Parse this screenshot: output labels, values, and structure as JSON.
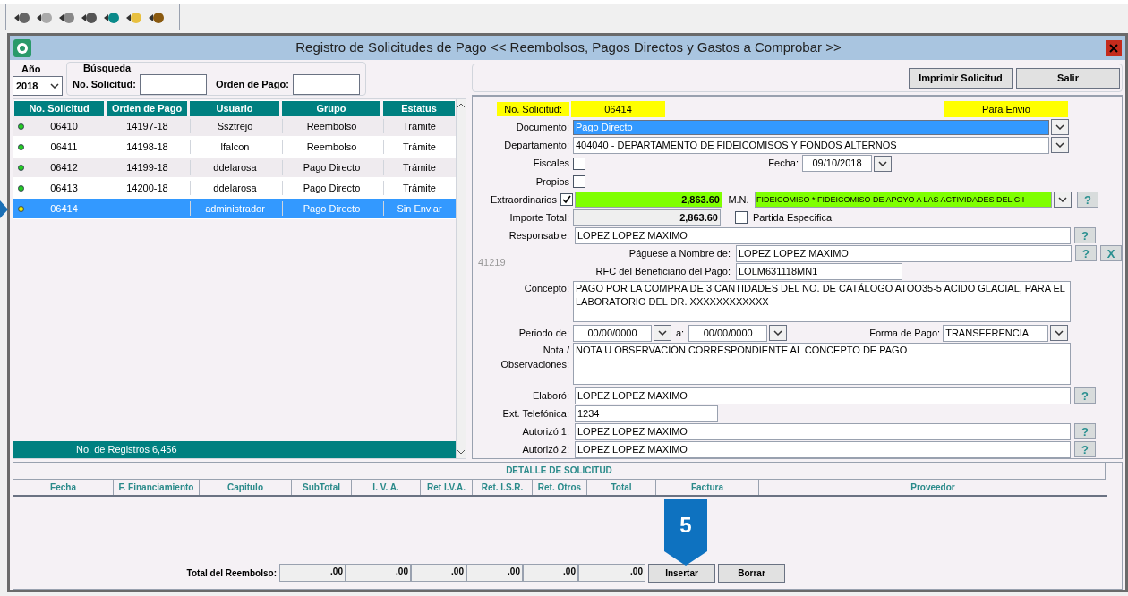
{
  "window": {
    "title": "Registro de Solicitudes de Pago << Reembolsos, Pagos Directos y Gastos a Comprobar >>"
  },
  "year": {
    "label": "Año",
    "value": "2018"
  },
  "search": {
    "label": "Búsqueda",
    "fields": [
      {
        "label": "No. Solicitud:"
      },
      {
        "label": "Orden de Pago:"
      }
    ]
  },
  "buttons": [
    "Imprimir Solicitud",
    "Salir"
  ],
  "table": {
    "columns": [
      "No. Solicitud",
      "Orden de Pago",
      "Usuario",
      "Grupo",
      "Estatus"
    ],
    "rows": [
      {
        "cells": [
          "06410",
          "14197-18",
          "Ssztrejo",
          "Reembolso",
          "Trámite"
        ],
        "color": "#22cc22",
        "selected": false
      },
      {
        "cells": [
          "06411",
          "14198-18",
          "lfalcon",
          "Reembolso",
          "Trámite"
        ],
        "color": "#22cc22",
        "selected": false
      },
      {
        "cells": [
          "06412",
          "14199-18",
          "ddelarosa",
          "Pago Directo",
          "Trámite"
        ],
        "color": "#22cc22",
        "selected": false
      },
      {
        "cells": [
          "06413",
          "14200-18",
          "ddelarosa",
          "Pago Directo",
          "Trámite"
        ],
        "color": "#22cc22",
        "selected": false
      },
      {
        "cells": [
          "06414",
          "",
          "administrador",
          "Pago Directo",
          "Sin Enviar"
        ],
        "color": "#eeee00",
        "selected": true
      }
    ],
    "footer": "No. de Registros 6,456"
  },
  "form": {
    "solicitud": {
      "label": "No. Solicitud:",
      "value": "06414",
      "status": "Para Envio"
    },
    "documento": {
      "label": "Documento:",
      "value": "Pago Directo"
    },
    "departamento": {
      "label": "Departamento:",
      "value": "404040 - DEPARTAMENTO DE FIDEICOMISOS Y FONDOS ALTERNOS"
    },
    "fiscales": {
      "label": "Fiscales",
      "checked": false
    },
    "fecha": {
      "label": "Fecha:",
      "value": "09/10/2018"
    },
    "propios": {
      "label": "Propios",
      "checked": false
    },
    "extraordinarios": {
      "label": "Extraordinarios",
      "checked": true,
      "amount": "2,863.60",
      "currency": "M.N.",
      "fund": "FIDEICOMISO * FIDEICOMISO DE APOYO A LAS ACTIVIDADES DEL CII"
    },
    "importe": {
      "label": "Importe Total:",
      "value": "2,863.60"
    },
    "partida": {
      "label": "Partida Especifica",
      "checked": false
    },
    "responsable": {
      "label": "Responsable:",
      "value": "LOPEZ LOPEZ MAXIMO"
    },
    "side_number": "41219",
    "paguese": {
      "label": "Páguese a Nombre de:",
      "value": "LOPEZ LOPEZ MAXIMO"
    },
    "rfc": {
      "label": "RFC del Beneficiario del Pago:",
      "value": "LOLM631118MN1"
    },
    "concepto": {
      "label": "Concepto:",
      "value": "PAGO POR LA COMPRA DE 3 CANTIDADES DEL NO. DE CATÁLOGO ATOO35-5 ACIDO GLACIAL, PARA EL LABORATORIO DEL DR. XXXXXXXXXXXX"
    },
    "periodo": {
      "label": "Periodo de:",
      "from": "00/00/0000",
      "to_label": "a:",
      "to": "00/00/0000"
    },
    "forma": {
      "label": "Forma de Pago:",
      "value": "TRANSFERENCIA"
    },
    "nota": {
      "label": "Nota / Observaciones:",
      "value": "NOTA U OBSERVACIÓN CORRESPONDIENTE AL CONCEPTO DE PAGO"
    },
    "elaboro": {
      "label": "Elaboró:",
      "value": "LOPEZ LOPEZ MAXIMO"
    },
    "ext": {
      "label": "Ext. Telefónica:",
      "value": "1234"
    },
    "autorizo1": {
      "label": "Autorizó 1:",
      "value": "LOPEZ LOPEZ MAXIMO"
    },
    "autorizo2": {
      "label": "Autorizó 2:",
      "value": "LOPEZ LOPEZ MAXIMO"
    },
    "help": "?",
    "clear": "X"
  },
  "detail": {
    "title": "DETALLE DE SOLICITUD",
    "columns": [
      "Fecha",
      "F. Financiamiento",
      "Capitulo",
      "SubTotal",
      "I. V. A.",
      "Ret I.V.A.",
      "Ret. I.S.R.",
      "Ret. Otros",
      "Total",
      "Factura",
      "Proveedor"
    ],
    "total_label": "Total del Reembolso:",
    "totals": [
      ".00",
      ".00",
      ".00",
      ".00",
      ".00",
      ".00"
    ],
    "buttons": [
      "Insertar",
      "Borrar"
    ]
  },
  "callout": "5"
}
